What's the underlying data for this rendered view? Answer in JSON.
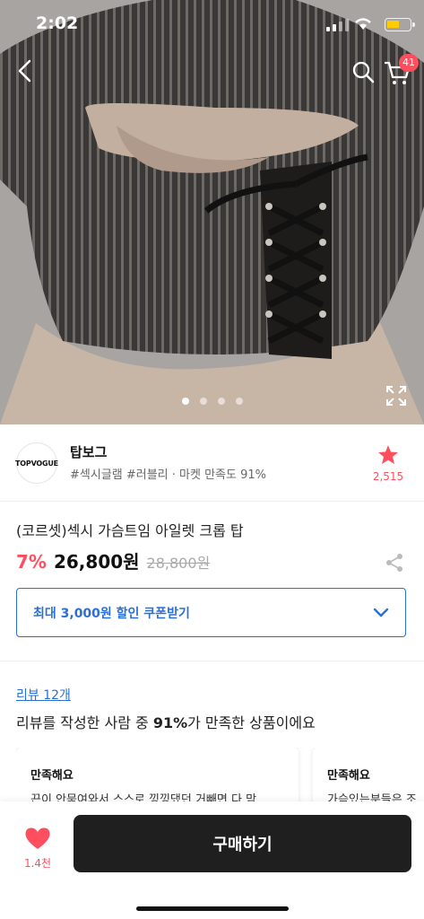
{
  "status_bar": {
    "time": "2:02"
  },
  "hero": {
    "cart_count": "41",
    "slide_count": 4,
    "active_slide": 0
  },
  "store": {
    "logo_text": "TOPVOGUE",
    "name": "탑보그",
    "tags": "#섹시글램 #러블리 · 마켓 만족도 91%",
    "favorites": "2,515"
  },
  "product": {
    "name": "(코르셋)섹시 가슴트임 아일렛 크롭 탑",
    "discount": "7%",
    "price": "26,800원",
    "original_price": "28,800원"
  },
  "coupon": {
    "label": "최대 3,000원 할인 쿠폰받기"
  },
  "reviews": {
    "link": "리뷰 12개",
    "summary_prefix": "리뷰를 작성한 사람 중 ",
    "summary_percent": "91%",
    "summary_suffix": "가 만족한 상품이에요",
    "cards": [
      {
        "title": "만족해요",
        "body": "끈이 안묶여와서 스스로 낑낑댔던 거빼면 다 맘"
      },
      {
        "title": "만족해요",
        "body": "가슴있는분들은 조"
      }
    ]
  },
  "bottom_bar": {
    "likes": "1.4천",
    "buy_label": "구매하기"
  },
  "colors": {
    "accent_red": "#ff4f5e",
    "accent_blue": "#2b6fd6",
    "buy_button": "#1f1f1f"
  },
  "icons": [
    "back-arrow-icon",
    "search-icon",
    "cart-icon",
    "expand-icon",
    "star-icon",
    "share-icon",
    "chevron-down-icon",
    "heart-icon"
  ]
}
